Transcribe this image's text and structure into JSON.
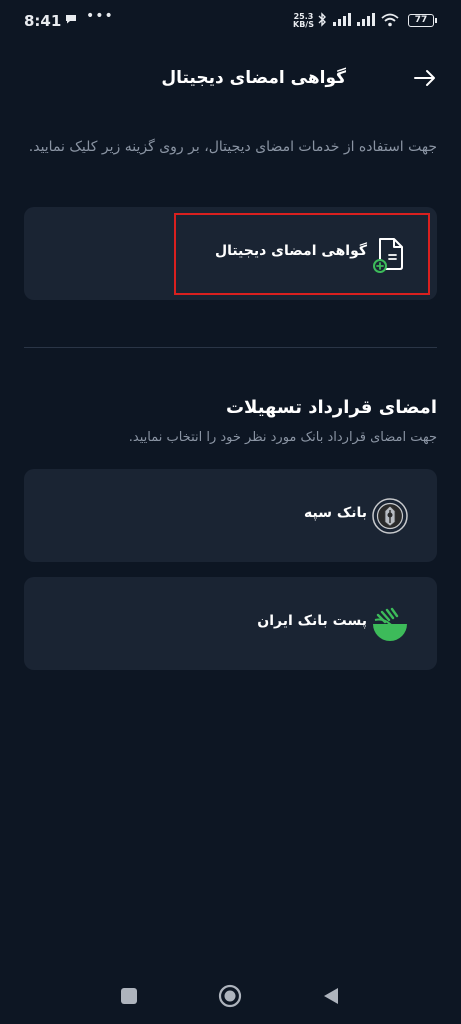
{
  "status_bar": {
    "time": "8:41",
    "net_speed_value": "25.3",
    "net_speed_unit": "KB/S",
    "battery": "77"
  },
  "header": {
    "title": "گواهی امضای دیجیتال",
    "back_icon": "arrow-right-icon"
  },
  "intro_text": "جهت استفاده از خدمات امضای دیجیتال، بر روی گزینه زیر کلیک نمایید.",
  "certificate_card": {
    "label": "گواهی امضای دیجیتال",
    "icon": "document-add-icon"
  },
  "contract_section": {
    "title": "امضای قرارداد تسهیلات",
    "subtitle": "جهت امضای قرارداد بانک مورد نظر خود را انتخاب نمایید."
  },
  "banks": [
    {
      "label": "بانک سپه",
      "icon": "sepah-bank-logo"
    },
    {
      "label": "پست بانک ایران",
      "icon": "post-bank-logo"
    }
  ],
  "colors": {
    "background": "#0d1623",
    "card": "#1a2433",
    "highlight": "#d9201f",
    "post_bank_green": "#3dbb5a"
  }
}
